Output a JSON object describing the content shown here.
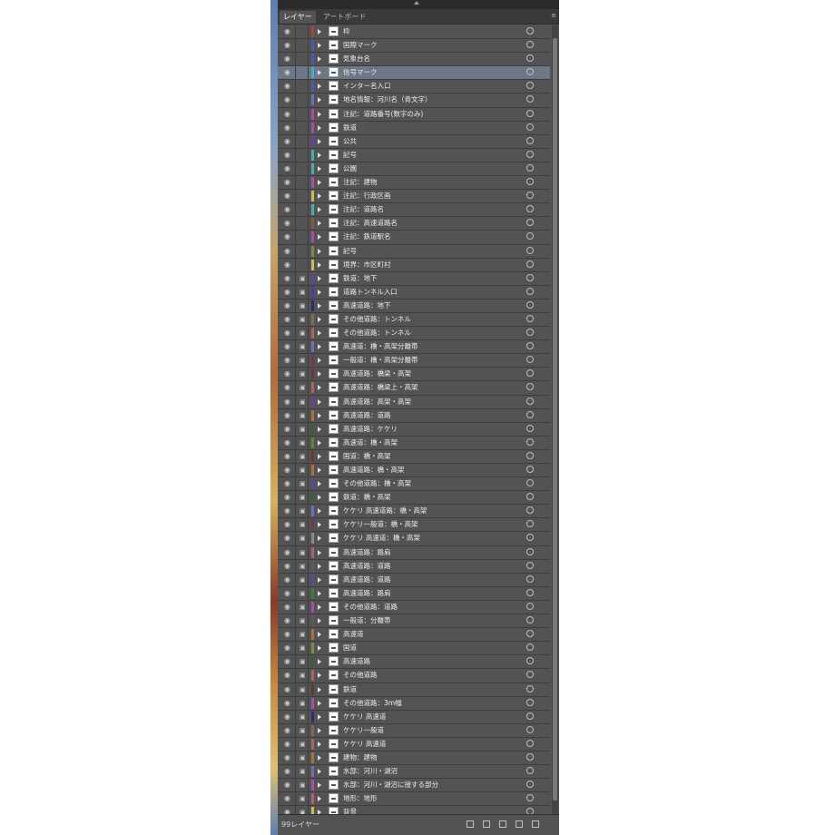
{
  "panel": {
    "tabs": [
      {
        "label": "レイヤー",
        "active": true
      },
      {
        "label": "アートボード",
        "active": false
      }
    ],
    "menu_icon": "panel-menu-icon",
    "footer": {
      "layer_count": "99レイヤー"
    },
    "colors": {
      "panel_bg": "#535353",
      "selected_row": "#6e7785"
    },
    "selected_index": 3,
    "layers": [
      {
        "name": "枠",
        "color": "#c0392b",
        "locked": false
      },
      {
        "name": "国際マーク",
        "color": "#3b5bd6",
        "locked": false
      },
      {
        "name": "気象台名",
        "color": "#3b5bd6",
        "locked": false
      },
      {
        "name": "信号マーク",
        "color": "#29b6c5",
        "locked": false
      },
      {
        "name": "インター名入口",
        "color": "#3b5bd6",
        "locked": false
      },
      {
        "name": "地名情報：河川名（青文字）",
        "color": "#6a6ad6",
        "locked": false
      },
      {
        "name": "注記：道路番号(数字のみ)",
        "color": "#c23ac2",
        "locked": false
      },
      {
        "name": "鉄道",
        "color": "#c23ac2",
        "locked": false
      },
      {
        "name": "公共",
        "color": "#6a3ac2",
        "locked": false
      },
      {
        "name": "記号",
        "color": "#29b6c5",
        "locked": false
      },
      {
        "name": "公園",
        "color": "#29b6c5",
        "locked": false
      },
      {
        "name": "注記：建物",
        "color": "#c23ac2",
        "locked": false
      },
      {
        "name": "注記：行政区画",
        "color": "#d6c02a",
        "locked": false
      },
      {
        "name": "注記：道路名",
        "color": "#29b6c5",
        "locked": false
      },
      {
        "name": "注記：高速道路名",
        "color": "#8a5a2a",
        "locked": false
      },
      {
        "name": "注記：鉄道駅名",
        "color": "#c23ac2",
        "locked": false
      },
      {
        "name": "記号",
        "color": "#8a8a2a",
        "locked": false
      },
      {
        "name": "境界：市区町村",
        "color": "#d6c02a",
        "locked": false
      },
      {
        "name": "鉄道：地下",
        "color": "#6a3ac2",
        "locked": true
      },
      {
        "name": "道路トンネル入口",
        "color": "#3a3ad6",
        "locked": true
      },
      {
        "name": "高速道路：地下",
        "color": "#2a2a8a",
        "locked": true
      },
      {
        "name": "その他道路：トンネル",
        "color": "#8a6a3a",
        "locked": true
      },
      {
        "name": "その他道路：トンネル",
        "color": "#c25a5a",
        "locked": true
      },
      {
        "name": "高速道：橋・高架分離帯",
        "color": "#6a6ad6",
        "locked": true
      },
      {
        "name": "一般道：橋・高架分離帯",
        "color": "#8a2a5a",
        "locked": true
      },
      {
        "name": "高速道路：橋梁・高架",
        "color": "#8a2a2a",
        "locked": true
      },
      {
        "name": "高速道路：橋梁上・高架",
        "color": "#c25a5a",
        "locked": true
      },
      {
        "name": "高速道路：高架・高架",
        "color": "#6a3ac2",
        "locked": true
      },
      {
        "name": "高速道路：道路",
        "color": "#c26a2a",
        "locked": true
      },
      {
        "name": "高速道路：ケケリ",
        "color": "#2a6a2a",
        "locked": true
      },
      {
        "name": "高速道：橋・高架",
        "color": "#5a8a2a",
        "locked": true
      },
      {
        "name": "国道：橋・高架",
        "color": "#8a2a2a",
        "locked": true
      },
      {
        "name": "高速道路：橋・高架",
        "color": "#c26a2a",
        "locked": true
      },
      {
        "name": "その他道路：橋・高架",
        "color": "#6a3ac2",
        "locked": true
      },
      {
        "name": "鉄道：橋・高架",
        "color": "#2a6a2a",
        "locked": true
      },
      {
        "name": "ケケリ 高速道路：橋・高架",
        "color": "#6a6ad6",
        "locked": true
      },
      {
        "name": "ケケリ一般道：橋・高架",
        "color": "#8a2a5a",
        "locked": true
      },
      {
        "name": "ケケリ 高速道：橋・高架",
        "color": "#8a8a8a",
        "locked": true
      },
      {
        "name": "高速道路：路肩",
        "color": "#c25a5a",
        "locked": true
      },
      {
        "name": "高速道路：道路",
        "color": "#5a5a5a",
        "locked": true
      },
      {
        "name": "高速道路：道路",
        "color": "#6a3ac2",
        "locked": true
      },
      {
        "name": "高速道路：路肩",
        "color": "#2a8a2a",
        "locked": true
      },
      {
        "name": "その他道路：道路",
        "color": "#c23ac2",
        "locked": true
      },
      {
        "name": "一般道：分離帯",
        "color": "#5a5a5a",
        "locked": true
      },
      {
        "name": "高速道",
        "color": "#c26a2a",
        "locked": true
      },
      {
        "name": "国道",
        "color": "#8a8a2a",
        "locked": true
      },
      {
        "name": "高速道路",
        "color": "#2a6a2a",
        "locked": true
      },
      {
        "name": "その他道路",
        "color": "#c25a5a",
        "locked": true
      },
      {
        "name": "鉄道",
        "color": "#5a3a2a",
        "locked": true
      },
      {
        "name": "その他道路：3m幅",
        "color": "#c23ac2",
        "locked": true
      },
      {
        "name": "ケケリ 高速道",
        "color": "#2a2a8a",
        "locked": true
      },
      {
        "name": "ケケリ一般道",
        "color": "#8a6a3a",
        "locked": true
      },
      {
        "name": "ケケリ 高速道",
        "color": "#c25a5a",
        "locked": true
      },
      {
        "name": "建物：建物",
        "color": "#c26a2a",
        "locked": true
      },
      {
        "name": "水部：河川・湖沼",
        "color": "#6a6ad6",
        "locked": true
      },
      {
        "name": "水部：河川・湖沼に接する部分",
        "color": "#c23ac2",
        "locked": true
      },
      {
        "name": "地形：地形",
        "color": "#c25a5a",
        "locked": true
      },
      {
        "name": "背景",
        "color": "#d6c02a",
        "locked": true
      }
    ]
  }
}
